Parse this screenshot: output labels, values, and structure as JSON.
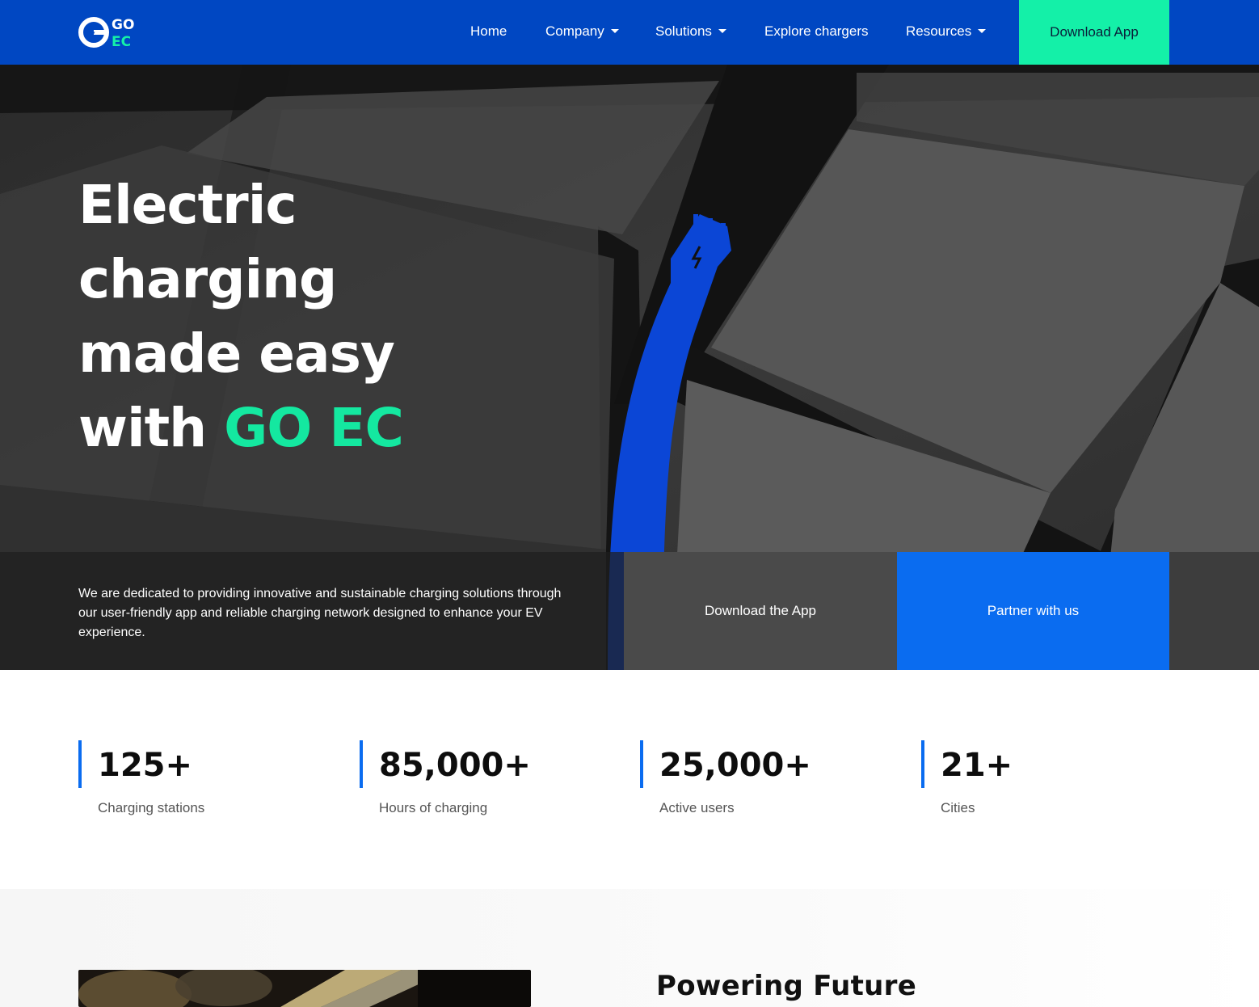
{
  "nav": {
    "logo_alt": "GO EC",
    "items": [
      {
        "label": "Home",
        "dropdown": false
      },
      {
        "label": "Company",
        "dropdown": true
      },
      {
        "label": "Solutions",
        "dropdown": true
      },
      {
        "label": "Explore chargers",
        "dropdown": false
      },
      {
        "label": "Resources",
        "dropdown": true
      }
    ],
    "cta": "Download App"
  },
  "hero": {
    "title_line1": "Electric",
    "title_line2": "charging",
    "title_line3": "made easy",
    "title_line4_prefix": "with ",
    "title_accent": "GO EC",
    "description": "We are dedicated to providing innovative and sustainable charging solutions through our user-friendly app and reliable charging network designed to enhance your EV experience.",
    "btn_download": "Download the App",
    "btn_partner": "Partner with us"
  },
  "stats": [
    {
      "value": "125+",
      "label": "Charging stations"
    },
    {
      "value": "85,000+",
      "label": "Hours of charging"
    },
    {
      "value": "25,000+",
      "label": "Active users"
    },
    {
      "value": "21+",
      "label": "Cities"
    }
  ],
  "section2": {
    "title": "Powering Future"
  },
  "colors": {
    "nav_bg": "#0047c2",
    "accent_green": "#14f0a8",
    "accent_blue": "#0a6cf0"
  }
}
